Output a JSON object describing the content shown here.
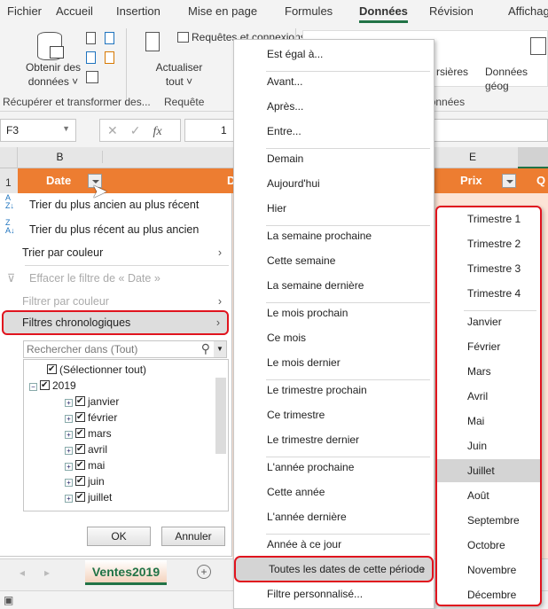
{
  "ribbon_tabs": [
    "Fichier",
    "Accueil",
    "Insertion",
    "Mise en page",
    "Formules",
    "Données",
    "Révision",
    "Affichage"
  ],
  "active_tab": "Données",
  "ribbon": {
    "get_data": "Obtenir des données",
    "get_data_l1": "Obtenir des",
    "get_data_l2": "données ˅",
    "refresh_l1": "Actualiser",
    "refresh_l2": "tout ˅",
    "queries": "Requêtes et connexions",
    "stocks": "rsières",
    "geo": "Données géog",
    "group1": "Récupérer et transformer des...",
    "group2": "Requête",
    "group3": "Types de données"
  },
  "formula_bar": {
    "name_box": "F3",
    "cancel": "✕",
    "enter": "✓",
    "fx": "fx",
    "value": "1"
  },
  "columns": {
    "b": "B",
    "e": "E"
  },
  "row_number": "1",
  "headers": {
    "date": "Date",
    "d": "D",
    "prix": "Prix",
    "q": "Q"
  },
  "filter_panel": {
    "sort_asc": "Trier du plus ancien au plus récent",
    "sort_desc": "Trier du plus récent au plus ancien",
    "sort_color": "Trier par couleur",
    "clear_filter": "Effacer le filtre de « Date »",
    "filter_color": "Filtrer par couleur",
    "date_filters": "Filtres chronologiques",
    "search_placeholder": "Rechercher dans (Tout)",
    "tree": [
      "(Sélectionner tout)",
      "2019",
      "janvier",
      "février",
      "mars",
      "avril",
      "mai",
      "juin",
      "juillet"
    ],
    "ok": "OK",
    "cancel": "Annuler"
  },
  "date_filter_menu": [
    [
      "Est égal à..."
    ],
    [
      "Avant...",
      "Après...",
      "Entre..."
    ],
    [
      "Demain",
      "Aujourd'hui",
      "Hier"
    ],
    [
      "La semaine prochaine",
      "Cette semaine",
      "La semaine dernière"
    ],
    [
      "Le mois prochain",
      "Ce mois",
      "Le mois dernier"
    ],
    [
      "Le trimestre prochain",
      "Ce trimestre",
      "Le trimestre dernier"
    ],
    [
      "L'année prochaine",
      "Cette année",
      "L'année dernière"
    ],
    [
      "Année à ce jour",
      "Toutes les dates de cette période",
      "Filtre personnalisé..."
    ]
  ],
  "date_filter_highlighted": "Toutes les dates de cette période",
  "period_menu": [
    [
      "Trimestre 1",
      "Trimestre 2",
      "Trimestre 3",
      "Trimestre 4"
    ],
    [
      "Janvier",
      "Février",
      "Mars",
      "Avril",
      "Mai",
      "Juin",
      "Juillet",
      "Août",
      "Septembre",
      "Octobre",
      "Novembre",
      "Décembre"
    ]
  ],
  "period_highlighted": "Juillet",
  "sheet_tab": "Ventes2019",
  "add_sheet": "+",
  "colors": {
    "header": "#ed7d31",
    "accent": "#217346",
    "highlight_outline": "#e0141e"
  }
}
